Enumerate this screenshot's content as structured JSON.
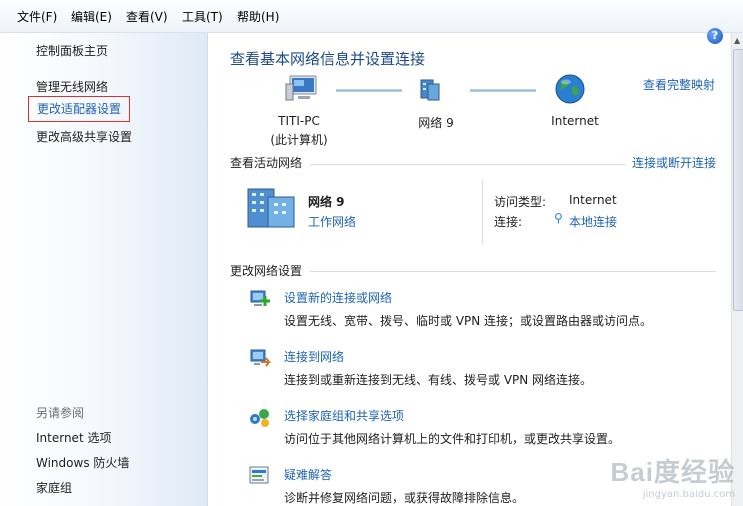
{
  "menu": {
    "file": "文件(F)",
    "edit": "编辑(E)",
    "view": "查看(V)",
    "tools": "工具(T)",
    "help": "帮助(H)"
  },
  "sidebar": {
    "home": "控制面板主页",
    "items": [
      "管理无线网络",
      "更改适配器设置",
      "更改高级共享设置"
    ],
    "see_also_title": "另请参阅",
    "see_also": [
      "Internet 选项",
      "Windows 防火墙",
      "家庭组"
    ]
  },
  "main": {
    "title": "查看基本网络信息并设置连接",
    "full_map_link": "查看完整映射",
    "map": {
      "computer_name": "TITI-PC",
      "computer_sub": "(此计算机)",
      "network": "网络  9",
      "internet": "Internet"
    },
    "active_header": "查看活动网络",
    "connect_disconnect_link": "连接或断开连接",
    "active": {
      "name": "网络  9",
      "type_link": "工作网络",
      "access_label": "访问类型:",
      "access_value": "Internet",
      "conn_label": "连接:",
      "conn_value": "本地连接"
    },
    "change_header": "更改网络设置",
    "tasks": [
      {
        "title": "设置新的连接或网络",
        "desc": "设置无线、宽带、拨号、临时或 VPN 连接；或设置路由器或访问点。"
      },
      {
        "title": "连接到网络",
        "desc": "连接到或重新连接到无线、有线、拨号或 VPN 网络连接。"
      },
      {
        "title": "选择家庭组和共享选项",
        "desc": "访问位于其他网络计算机上的文件和打印机，或更改共享设置。"
      },
      {
        "title": "疑难解答",
        "desc": "诊断并修复网络问题，或获得故障排除信息。"
      }
    ]
  },
  "watermark": {
    "brand": "Bai度经验",
    "url": "jingyan.baidu.com"
  },
  "colors": {
    "link": "#1e63b6",
    "title": "#1d4a8a",
    "selected_border": "#d9322f"
  }
}
